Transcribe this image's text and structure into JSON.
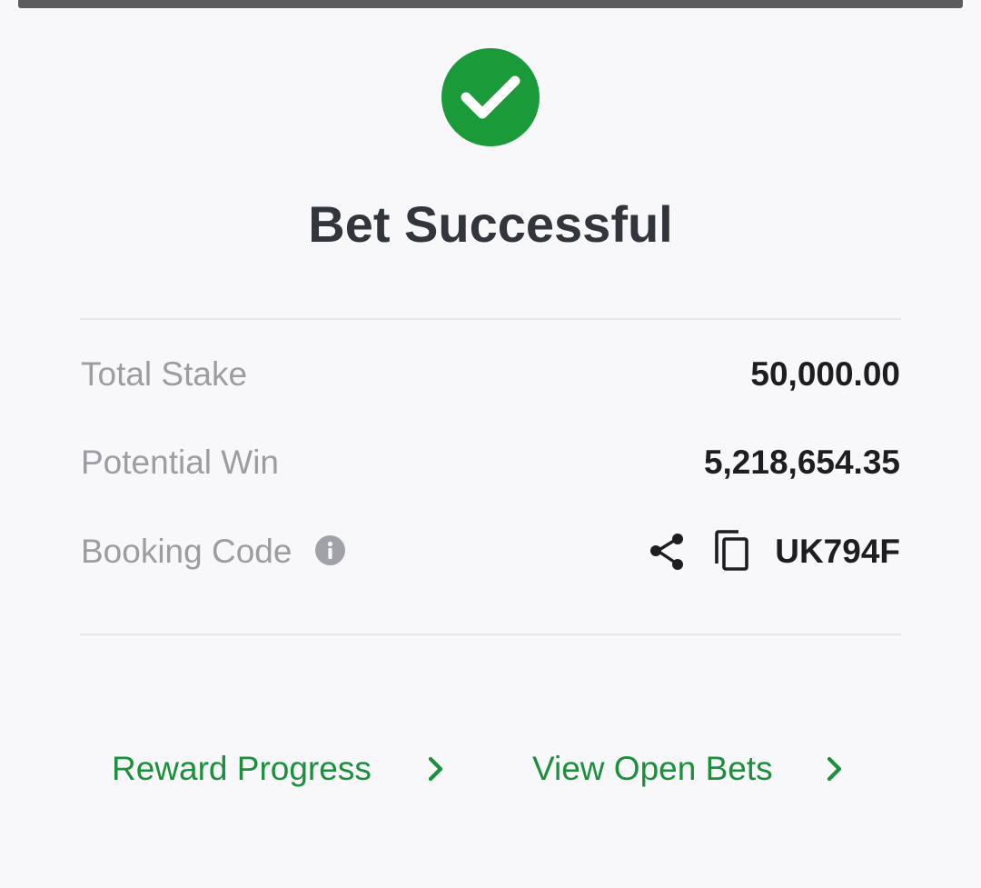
{
  "header": {
    "title": "Bet Successful",
    "status_icon": "check-circle-icon",
    "accent_color": "#1b9a3a"
  },
  "details": {
    "total_stake": {
      "label": "Total Stake",
      "value": "50,000.00"
    },
    "potential_win": {
      "label": "Potential Win",
      "value": "5,218,654.35"
    },
    "booking_code": {
      "label": "Booking Code",
      "value": "UK794F",
      "info_icon": "info-icon",
      "share_icon": "share-icon",
      "copy_icon": "copy-icon"
    }
  },
  "actions": {
    "reward_progress": {
      "label": "Reward Progress",
      "icon": "chevron-right-icon"
    },
    "view_open_bets": {
      "label": "View Open Bets",
      "icon": "chevron-right-icon"
    },
    "link_color": "#1c8f3c"
  }
}
